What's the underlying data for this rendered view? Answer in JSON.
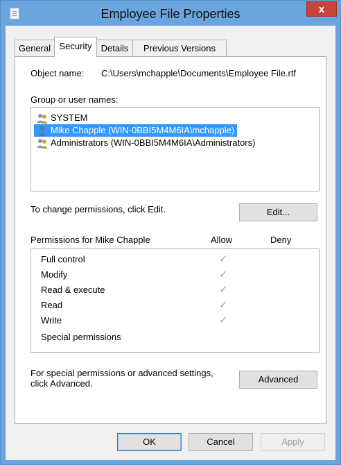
{
  "window": {
    "title": "Employee File Properties",
    "close_label": "x"
  },
  "tabs": [
    {
      "label": "General",
      "active": false
    },
    {
      "label": "Security",
      "active": true
    },
    {
      "label": "Details",
      "active": false
    },
    {
      "label": "Previous Versions",
      "active": false
    }
  ],
  "security": {
    "object_name_label": "Object name:",
    "object_name_value": "C:\\Users\\mchapple\\Documents\\Employee File.rtf",
    "group_label": "Group or user names:",
    "users": [
      {
        "name": "SYSTEM",
        "icon": "users-group-icon",
        "selected": false
      },
      {
        "name": "Mike Chapple (WIN-0BBI5M4M6IA\\mchapple)",
        "icon": "user-icon",
        "selected": true
      },
      {
        "name": "Administrators (WIN-0BBI5M4M6IA\\Administrators)",
        "icon": "users-group-icon",
        "selected": false
      }
    ],
    "change_text": "To change permissions, click Edit.",
    "edit_label": "Edit...",
    "permissions_for": "Permissions for Mike Chapple",
    "allow_header": "Allow",
    "deny_header": "Deny",
    "permissions": [
      {
        "name": "Full control",
        "allow": true,
        "deny": false
      },
      {
        "name": "Modify",
        "allow": true,
        "deny": false
      },
      {
        "name": "Read & execute",
        "allow": true,
        "deny": false
      },
      {
        "name": "Read",
        "allow": true,
        "deny": false
      },
      {
        "name": "Write",
        "allow": true,
        "deny": false
      },
      {
        "name": "Special permissions",
        "allow": false,
        "deny": false
      }
    ],
    "special_text_line1": "For special permissions or advanced settings,",
    "special_text_line2": "click Advanced.",
    "advanced_label": "Advanced"
  },
  "buttons": {
    "ok": "OK",
    "cancel": "Cancel",
    "apply": "Apply"
  },
  "colors": {
    "titlebar": "#6aa6dd",
    "close": "#c7463b",
    "selection": "#3399ff",
    "check_disabled": "#a8a8a8"
  }
}
